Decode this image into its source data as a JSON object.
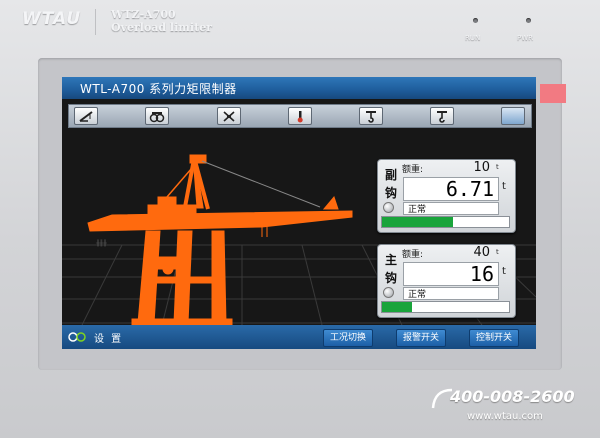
{
  "brand": {
    "logo": "WTAU",
    "model": "WTZ-A700",
    "subtitle": "Overload limiter"
  },
  "leds": [
    {
      "label": "RUN"
    },
    {
      "label": "PWR"
    }
  ],
  "screen": {
    "title": "WTL-A700 系列力矩限制器",
    "toolbar_icons": [
      "boom-crane-icon",
      "tire-icon",
      "slewing-icon",
      "thermometer-icon",
      "main-hook-icon",
      "aux-hook-icon",
      "blank-icon"
    ]
  },
  "cards": [
    {
      "hook_char1": "副",
      "hook_char2": "钩",
      "rated_label": "额重:",
      "rated_value": "10",
      "rated_unit": "t",
      "load_value": "6.71",
      "load_unit": "t",
      "status": "正常",
      "load_ratio": 0.56,
      "bar_color": "#19a43b"
    },
    {
      "hook_char1": "主",
      "hook_char2": "钩",
      "rated_label": "额重:",
      "rated_value": "40",
      "rated_unit": "t",
      "load_value": "16",
      "load_unit": "t",
      "status": "正常",
      "load_ratio": 0.24,
      "bar_color": "#19a43b"
    }
  ],
  "bottom": {
    "settings_label": "设 置",
    "buttons": [
      "工况切换",
      "报警开关",
      "控制开关"
    ]
  },
  "footer": {
    "phone": "400-008-2600",
    "website": "www.wtau.com"
  },
  "colors": {
    "crane": "#ff6a0e",
    "title_blue": "#1e5c9b",
    "accent_stripe": "#f27a82"
  }
}
